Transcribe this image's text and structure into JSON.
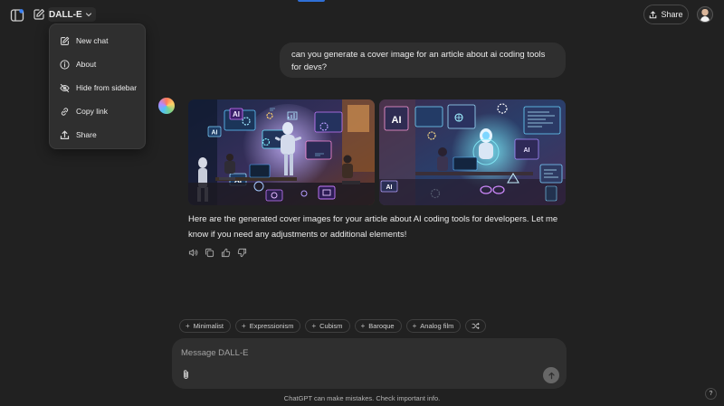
{
  "header": {
    "model_name": "DALL-E",
    "share_label": "Share"
  },
  "model_menu": {
    "items": [
      {
        "label": "New chat",
        "icon": "new-chat-icon"
      },
      {
        "label": "About",
        "icon": "info-icon"
      },
      {
        "label": "Hide from sidebar",
        "icon": "eye-off-icon"
      },
      {
        "label": "Copy link",
        "icon": "link-icon"
      },
      {
        "label": "Share",
        "icon": "share-icon"
      }
    ]
  },
  "conversation": {
    "user_message": "can you generate a cover image for an article about ai coding tools for devs?",
    "assistant_message": "Here are the generated cover images for your article about AI coding tools for developers. Let me know if you need any adjustments or additional elements!",
    "image_1_text": {
      "ai_a": "AI",
      "ai_b": "AI",
      "ai_c": "AI"
    },
    "image_2_text": {
      "ai_a": "AI",
      "ai_b": "AI",
      "ai_c": "AI"
    },
    "message_actions": [
      "read-aloud-icon",
      "copy-icon",
      "thumbs-up-icon",
      "thumbs-down-icon"
    ]
  },
  "style_chips": [
    {
      "label": "Minimalist"
    },
    {
      "label": "Expressionism"
    },
    {
      "label": "Cubism"
    },
    {
      "label": "Baroque"
    },
    {
      "label": "Analog film"
    }
  ],
  "composer": {
    "placeholder": "Message DALL-E"
  },
  "footer": {
    "disclaimer": "ChatGPT can make mistakes. Check important info.",
    "help_label": "?"
  },
  "colors": {
    "background": "#212121",
    "surface": "#2f2f2f",
    "accent_top": "#2f6fd6"
  }
}
